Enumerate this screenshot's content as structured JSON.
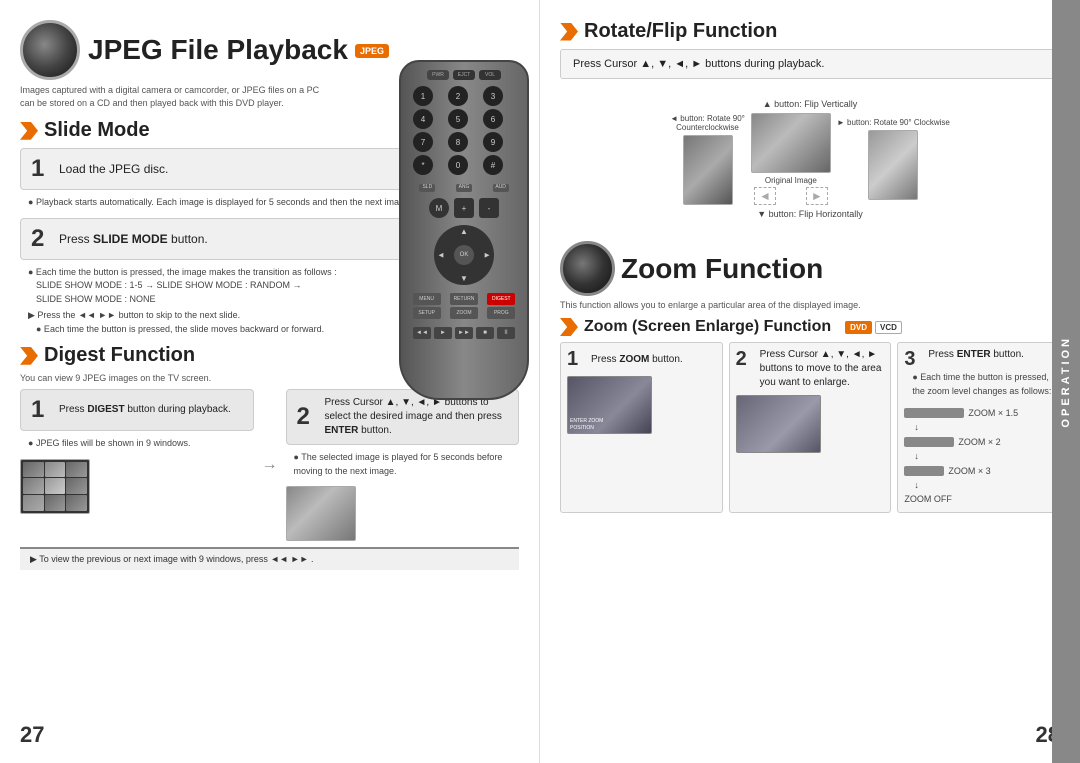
{
  "left_page": {
    "page_number": "27",
    "jpeg_title": "JPEG File Playback",
    "jpeg_badge": "JPEG",
    "jpeg_subtitle1": "Images captured with a digital camera or camcorder, or JPEG files on a PC",
    "jpeg_subtitle2": "can be stored on a CD and then played back with this DVD player.",
    "slide_mode_title": "Slide Mode",
    "step1_label": "1",
    "step1_text": "Load the JPEG disc.",
    "playback_note": "Playback starts automatically. Each image is displayed for 5 seconds and then the next image is displayed.",
    "step2_label": "2",
    "step2_text": "Press SLIDE MODE button.",
    "slide_notes": [
      "Each time the button is pressed, the image makes the transition as follows :",
      "SLIDE SHOW MODE : 1-5 → SLIDE SHOW MODE : RANDOM →",
      "SLIDE SHOW MODE : NONE"
    ],
    "skip_note": "Press the ◄◄ ►► button to skip to the next slide.",
    "skip_detail": "Each time the button is pressed, the slide moves backward or forward.",
    "digest_title": "Digest Function",
    "digest_subtitle": "You can view 9 JPEG images on the TV screen.",
    "digest_step1_num": "1",
    "digest_step1_text": "Press DIGEST button during playback.",
    "digest_step1_note": "JPEG files will be shown in 9 windows.",
    "digest_step2_num": "2",
    "digest_step2_text": "Press Cursor ▲, ▼, ◄, ► buttons to select the desired image and then press ENTER button.",
    "digest_step2_note": "The selected image is played for 5 seconds before moving to the next image.",
    "navigate_note": "To view the previous or next image with 9 windows, press ◄◄ ►► ."
  },
  "right_page": {
    "page_number": "28",
    "rotate_title": "Rotate/Flip Function",
    "rotate_info": "Press Cursor ▲, ▼, ◄, ► buttons during playback.",
    "rotate_labels": {
      "flip_vertically": "▲ button: Flip Vertically",
      "rotate_ccw": "◄ button: Rotate 90° Counterclockwise",
      "rotate_cw": "► button: Rotate 90° Clockwise",
      "original": "Original Image",
      "flip_horizontally": "▼ button: Flip Horizontally"
    },
    "zoom_title": "Zoom Function",
    "zoom_subtitle": "This function allows you to enlarge a particular area of the displayed image.",
    "zoom_screen_title": "Zoom (Screen Enlarge) Function",
    "dvd_badge": "DVD",
    "vcd_badge": "VCD",
    "zoom_step1_num": "1",
    "zoom_step1_text": "Press ZOOM button.",
    "zoom_step2_num": "2",
    "zoom_step2_text": "Press Cursor ▲, ▼, ◄, ► buttons to move to the area you want to enlarge.",
    "zoom_step3_num": "3",
    "zoom_step3_text": "Press ENTER button.",
    "zoom_step3_note": "Each time the button is pressed, the zoom level changes as follows:",
    "zoom_screen_label": "ENTER ZOOM\nPOSITION",
    "zoom_levels": [
      "ZOOM × 1.5",
      "↓",
      "ZOOM × 2",
      "↓",
      "ZOOM × 3",
      "↓",
      "ZOOM OFF"
    ],
    "operation_label": "OPERATION"
  }
}
